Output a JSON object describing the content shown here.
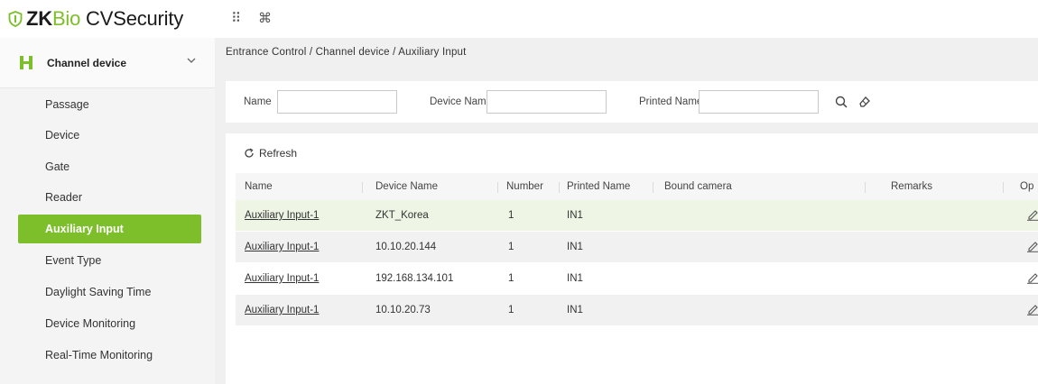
{
  "app": {
    "logo_zk": "ZK",
    "logo_bio": "Bio",
    "logo_cv": " CVSecurity",
    "accent_color": "#7cbf2b"
  },
  "topbar": {
    "apps_icon": "grid-dots-icon",
    "command_icon": "command-icon",
    "apps_glyph": "⠿",
    "command_glyph": "⌘"
  },
  "sidebar": {
    "module_label": "Channel device",
    "items": [
      {
        "label": "Passage"
      },
      {
        "label": "Device"
      },
      {
        "label": "Gate"
      },
      {
        "label": "Reader"
      },
      {
        "label": "Auxiliary Input",
        "active": true
      },
      {
        "label": "Event Type"
      },
      {
        "label": "Daylight Saving Time"
      },
      {
        "label": "Device Monitoring"
      },
      {
        "label": "Real-Time Monitoring"
      }
    ]
  },
  "breadcrumb": "Entrance Control / Channel device / Auxiliary Input",
  "filter": {
    "name_label": "Name",
    "name_value": "",
    "device_name_label": "Device Name",
    "device_name_value": "",
    "printed_name_label": "Printed Name",
    "printed_name_value": ""
  },
  "toolbar": {
    "refresh_label": "Refresh"
  },
  "table": {
    "columns": [
      "Name",
      "Device Name",
      "Number",
      "Printed Name",
      "Bound camera",
      "Remarks",
      "Op"
    ],
    "rows": [
      {
        "name": "Auxiliary Input-1",
        "device_name": "ZKT_Korea",
        "number": "1",
        "printed_name": "IN1",
        "bound_camera": "",
        "remarks": ""
      },
      {
        "name": "Auxiliary Input-1",
        "device_name": "10.10.20.144",
        "number": "1",
        "printed_name": "IN1",
        "bound_camera": "",
        "remarks": ""
      },
      {
        "name": "Auxiliary Input-1",
        "device_name": "192.168.134.101",
        "number": "1",
        "printed_name": "IN1",
        "bound_camera": "",
        "remarks": ""
      },
      {
        "name": "Auxiliary Input-1",
        "device_name": "10.10.20.73",
        "number": "1",
        "printed_name": "IN1",
        "bound_camera": "",
        "remarks": ""
      }
    ]
  }
}
